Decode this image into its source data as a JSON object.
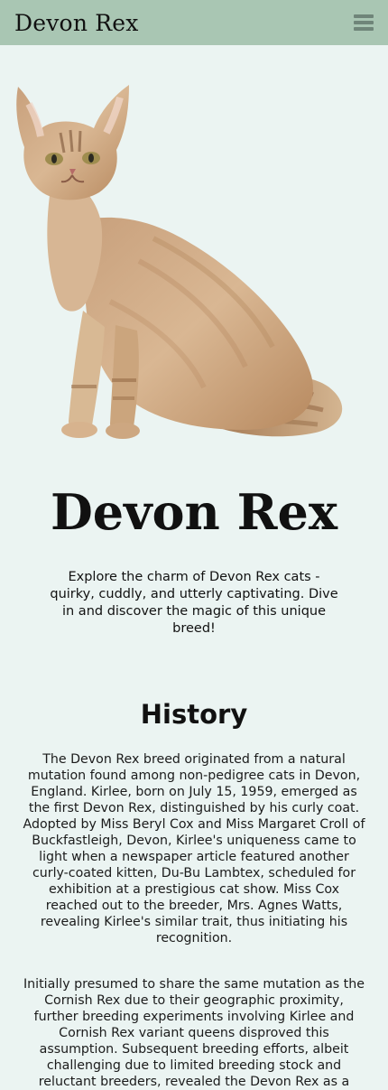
{
  "header": {
    "brand": "Devon Rex",
    "menu_icon": "hamburger-menu-icon"
  },
  "hero": {
    "image_alt": "Devon Rex cat sitting",
    "title": "Devon Rex",
    "subtitle": "Explore the charm of Devon Rex cats - quirky, cuddly, and utterly captivating. Dive in and discover the magic of this unique breed!"
  },
  "history": {
    "title": "History",
    "paragraphs": [
      "The Devon Rex breed originated from a natural mutation found among non-pedigree cats in Devon, England. Kirlee, born on July 15, 1959, emerged as the first Devon Rex, distinguished by his curly coat. Adopted by Miss Beryl Cox and Miss Margaret Croll of Buckfastleigh, Devon, Kirlee's uniqueness came to light when a newspaper article featured another curly-coated kitten, Du-Bu Lambtex, scheduled for exhibition at a prestigious cat show. Miss Cox reached out to the breeder, Mrs. Agnes Watts, revealing Kirlee's similar trait, thus initiating his recognition.",
      "Initially presumed to share the same mutation as the Cornish Rex due to their geographic proximity, further breeding experiments involving Kirlee and Cornish Rex variant queens disproved this assumption. Subsequent breeding efforts, albeit challenging due to limited breeding stock and reluctant breeders, revealed the Devon Rex as a"
    ]
  },
  "colors": {
    "header_bg": "#a9c6b3",
    "page_bg": "#ebf4f2"
  }
}
